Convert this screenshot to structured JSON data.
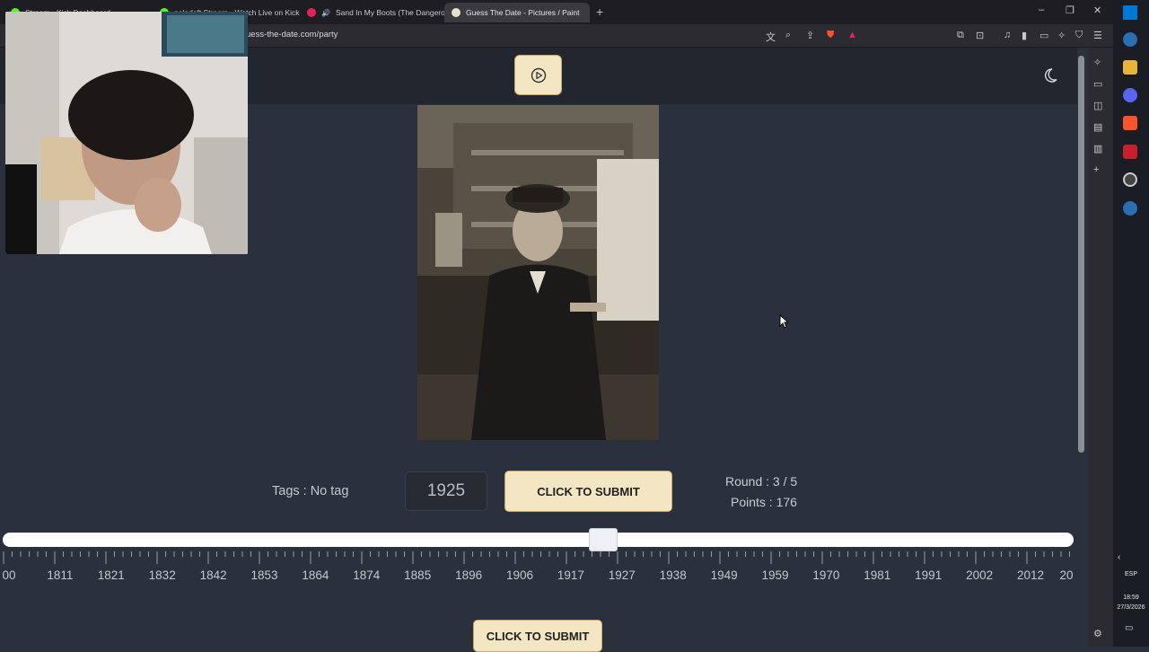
{
  "browser": {
    "tabs": [
      {
        "label": "Stream - Kick Dashboard",
        "color": "#53fc18"
      },
      {
        "label": "peladeft Stream - Watch Live on Kick",
        "color": "#53fc18"
      },
      {
        "label": "Sand In My Boots (The Dangerou",
        "color": "#e0245e"
      },
      {
        "label": "Guess The Date - Pictures / Paint",
        "color": "#e8e0c8"
      }
    ],
    "new_tab": "+",
    "url": "uess-the-date.com/party",
    "window_controls": {
      "minimize": "–",
      "restore": "❐",
      "close": "✕"
    }
  },
  "game": {
    "tags_text": "Tags : No tag",
    "year_value": "1925",
    "submit_label": "CLICK TO SUBMIT",
    "bottom_submit_label": "CLICK TO SUBMIT",
    "round_text": "Round : 3 / 5",
    "points_text": "Points : 176",
    "slider_value_year": 1925,
    "timeline_labels": [
      "00",
      "1811",
      "1821",
      "1832",
      "1842",
      "1853",
      "1864",
      "1874",
      "1885",
      "1896",
      "1906",
      "1917",
      "1927",
      "1938",
      "1949",
      "1959",
      "1970",
      "1981",
      "1991",
      "2002",
      "2012",
      "20"
    ]
  },
  "taskbar": {
    "language": "ESP",
    "time": "18:59",
    "date": "27/3/2026"
  },
  "colors": {
    "page_bg": "#2a303c",
    "button_bg": "#f5e6c3",
    "button_border": "#c9a76a"
  }
}
